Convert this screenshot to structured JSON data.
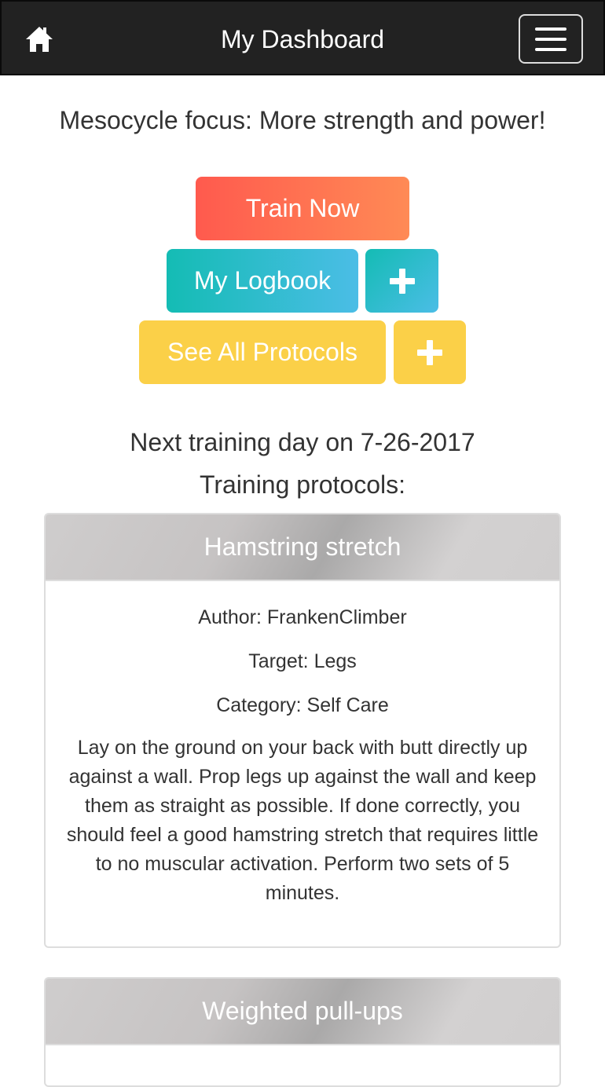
{
  "navbar": {
    "title": "My Dashboard",
    "home_icon": "home-icon",
    "menu_icon": "hamburger-menu-icon"
  },
  "focus": "Mesocycle focus: More strength and power!",
  "buttons": {
    "train_now": "Train Now",
    "my_logbook": "My Logbook",
    "see_all_protocols": "See All Protocols",
    "add_icon": "plus-icon"
  },
  "next_training": "Next training day on 7-26-2017",
  "protocols_heading": "Training protocols:",
  "protocols": [
    {
      "title": "Hamstring stretch",
      "author": "Author: FrankenClimber",
      "target": "Target: Legs",
      "category": "Category: Self Care",
      "description": "Lay on the ground on your back with butt directly up against a wall. Prop legs up against the wall and keep them as straight as possible. If done correctly, you should feel a good hamstring stretch that requires little to no muscular activation. Perform two sets of 5 minutes."
    },
    {
      "title": "Weighted pull-ups"
    }
  ],
  "colors": {
    "navbar": "#222222",
    "train_now": "#ff6b50",
    "logbook": "#2bbdc8",
    "protocols": "#fbd048",
    "card_header": "#c6c3c3"
  }
}
